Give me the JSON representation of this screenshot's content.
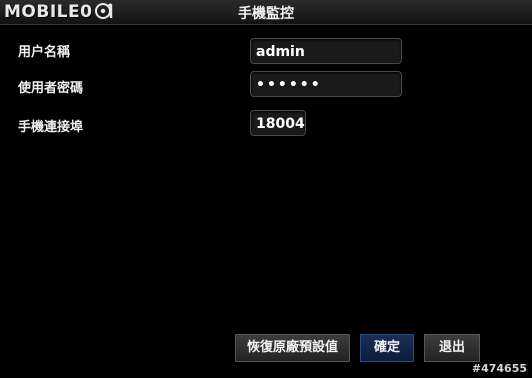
{
  "brand": {
    "logo_text": "MOBILE01"
  },
  "window": {
    "title": "手機監控"
  },
  "form": {
    "username_label": "用户名稱",
    "username_value": "admin",
    "password_label": "使用者密碼",
    "password_value": "••••••",
    "port_label": "手機連接埠",
    "port_value": "18004"
  },
  "buttons": {
    "restore_label": "恢復原廠預設值",
    "ok_label": "確定",
    "exit_label": "退出"
  },
  "watermark": {
    "text": "#474655"
  },
  "colors": {
    "background": "#000000",
    "ok_button": "#0c1c3c"
  }
}
